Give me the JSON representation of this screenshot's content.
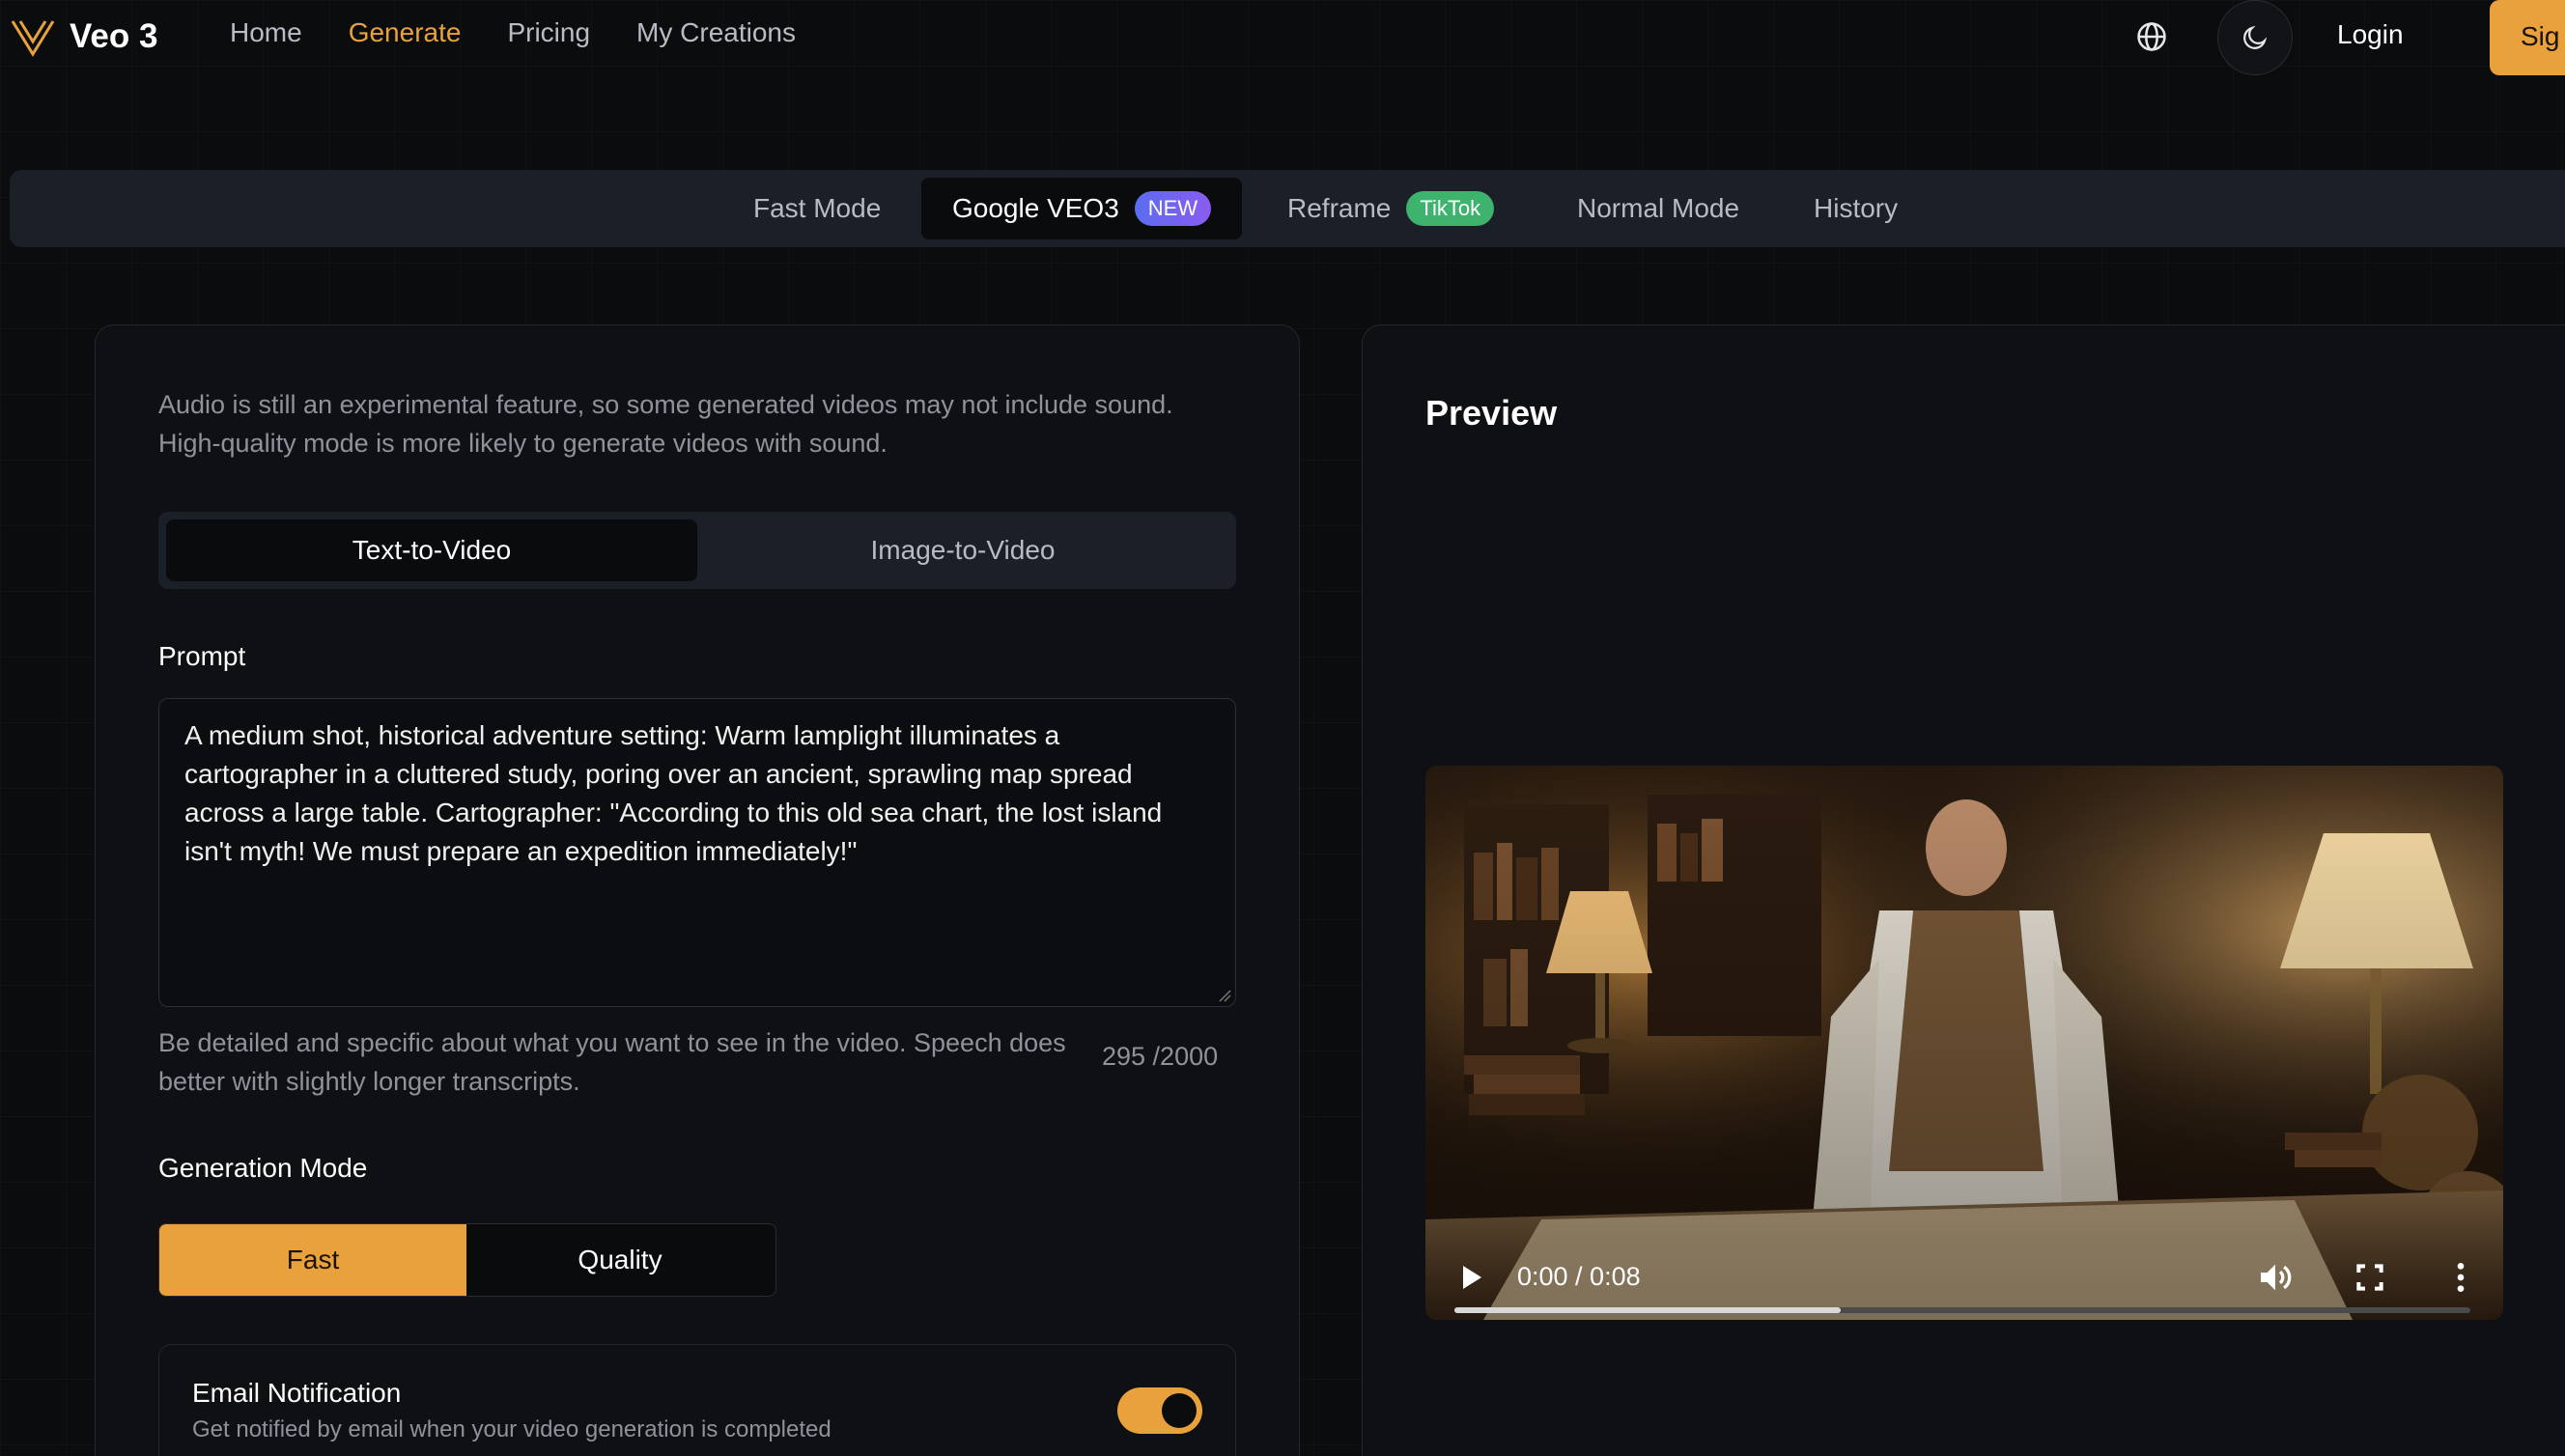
{
  "header": {
    "brand": "Veo 3",
    "nav": [
      "Home",
      "Generate",
      "Pricing",
      "My Creations"
    ],
    "active_nav": "Generate",
    "login": "Login",
    "signup": "Sig",
    "icons": {
      "language": "globe-icon",
      "theme": "moon-icon"
    }
  },
  "tabs": {
    "fast_mode": "Fast Mode",
    "google_veo3": "Google VEO3",
    "new_badge": "NEW",
    "reframe": "Reframe",
    "tiktok_badge": "TikTok",
    "normal_mode": "Normal Mode",
    "history": "History"
  },
  "form": {
    "audio_note": "Audio is still an experimental feature, so some generated videos may not include sound. High-quality mode is more likely to generate videos with sound.",
    "input_modes": {
      "text_to_video": "Text-to-Video",
      "image_to_video": "Image-to-Video",
      "selected": "Text-to-Video"
    },
    "prompt_label": "Prompt",
    "prompt_value": "A medium shot, historical adventure setting: Warm lamplight illuminates a cartographer in a cluttered study, poring over an ancient, sprawling map spread across a large table. Cartographer: \"According to this old sea chart, the lost island isn't myth! We must prepare an expedition immediately!\"",
    "prompt_help": "Be detailed and specific about what you want to see in the video. Speech does better with slightly longer transcripts.",
    "char_count": "295 /2000",
    "generation_mode_label": "Generation Mode",
    "generation_modes": {
      "fast": "Fast",
      "quality": "Quality",
      "selected": "Fast"
    },
    "email": {
      "title": "Email Notification",
      "description": "Get notified by email when your video generation is completed",
      "enabled": true
    }
  },
  "preview": {
    "title": "Preview",
    "time": "0:00 / 0:08",
    "progress_fraction": 0.38
  },
  "colors": {
    "accent": "#e9a23b",
    "background": "#0b0c0e",
    "surface": "#1b1f27",
    "new_badge": "#6b64f0",
    "tiktok_badge": "#3db36d"
  }
}
